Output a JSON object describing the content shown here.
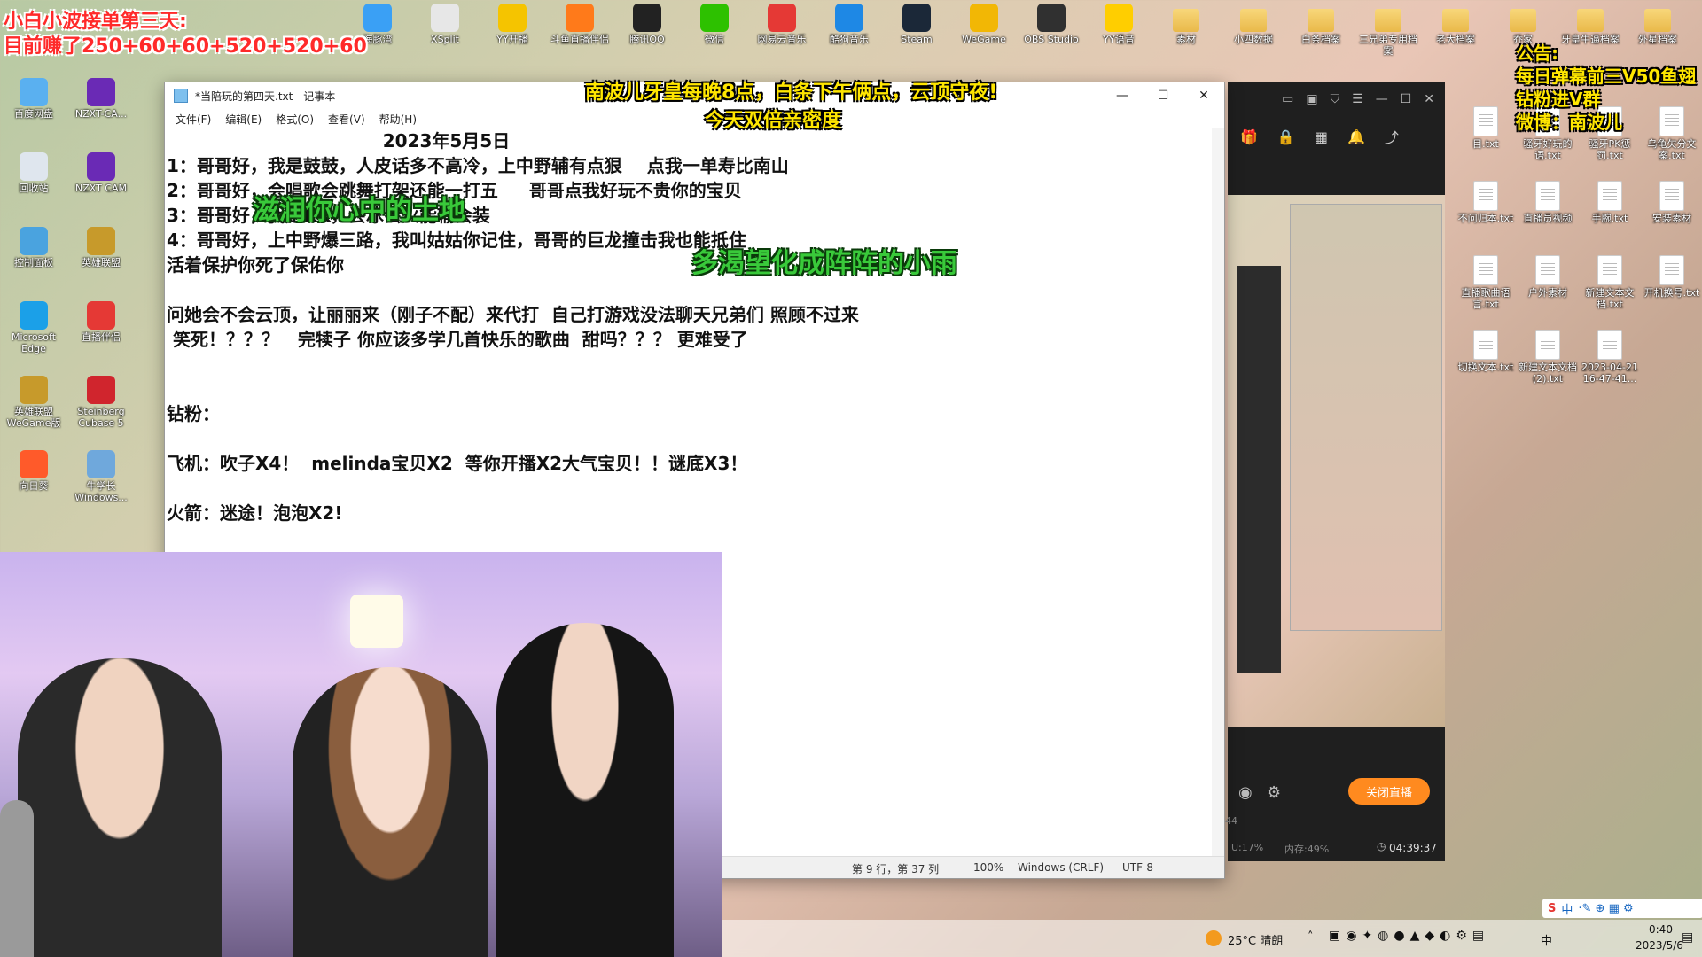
{
  "overlays": {
    "topleft_line1": "小白小波接单第三天:",
    "topleft_line2": "目前赚了250+60+60+520+520+60",
    "center_line1": "南波儿牙皇每晚8点，白条下午俩点，云顶守夜!",
    "center_line2": "今天双倍亲密度",
    "right_line1": "公告:",
    "right_line2": "每日弹幕前三V50鱼翅",
    "right_line3": "钻粉进V群",
    "right_line4": "微博：南波儿",
    "green_1": "滋润你心中的土地",
    "green_2": "多渴望化成阵阵的小雨"
  },
  "desktop_top_icons": [
    "海豚湾",
    "XSplit",
    "YY开播",
    "斗鱼直播伴侣",
    "腾讯QQ",
    "微信",
    "网易云音乐",
    "酷狗音乐",
    "Steam",
    "WeGame",
    "OBS Studio",
    "YY语音",
    "素材",
    "小四数据",
    "白条档案",
    "三兄弟专用档案",
    "老大档案",
    "乔家",
    "牙皇牛逼档案",
    "外星档案"
  ],
  "desktop_left_icons": [
    {
      "label": "百度网盘"
    },
    {
      "label": "NZXT-CA..."
    },
    {
      "label": "回收站"
    },
    {
      "label": "NZXT CAM"
    },
    {
      "label": "控制面板"
    },
    {
      "label": "英雄联盟"
    },
    {
      "label": "Microsoft Edge"
    },
    {
      "label": "直播伴侣"
    },
    {
      "label": "英雄联盟 WeGame版"
    },
    {
      "label": "Steinberg Cubase 5"
    },
    {
      "label": "向日葵"
    },
    {
      "label": "牛学长 Windows..."
    }
  ],
  "desktop_right_files": [
    "目.txt",
    "骚牙好玩的语.txt",
    "骚牙PK惩罚.txt",
    "乌龟欠分文案.txt",
    "不问归本.txt",
    "直播员视频",
    "手腕.txt",
    "安装素材",
    "直播歌曲语言.txt",
    "户外素材",
    "新建文本文档.txt",
    "开机换号.txt",
    "切换文本.txt",
    "新建文本文档 (2).txt",
    "2023-04-21 16-47-41..."
  ],
  "notepad": {
    "title": "*当陪玩的第四天.txt - 记事本",
    "menu": [
      "文件(F)",
      "编辑(E)",
      "格式(O)",
      "查看(V)",
      "帮助(H)"
    ],
    "content": "                                   2023年5月5日\n1：哥哥好，我是鼓鼓，人皮话多不高冷，上中野辅有点狠    点我一单寿比南山\n2：哥哥好，会唱歌会跳舞打架还能一打五     哥哥点我好玩不贵你的宝贝\n3：哥哥好，我是KK，会冰会火能输会装\n4：哥哥好，上中野爆三路，我叫姑姑你记住，哥哥的巨龙撞击我也能抵住\n活着保护你死了保佑你\n\n问她会不会云顶，让丽丽来（刚子不配）来代打  自己打游戏没法聊天兄弟们 照顾不过来\n 笑死！？？？   完犊子 你应该多学几首快乐的歌曲  甜吗？？？ 更难受了\n\n\n钻粉：\n\n飞机：吹子X4！  melinda宝贝X2  等你开播X2大气宝贝！！谜底X3！\n\n火箭：迷途！泡泡X2!",
    "status": {
      "position": "第 9 行，第 37 列",
      "zoom": "100%",
      "line_ending": "Windows (CRLF)",
      "encoding": "UTF-8"
    }
  },
  "panel": {
    "live_button": "关闭直播",
    "timer": "04:39:37",
    "cpu": "U:17%",
    "mem": "内存:49%",
    "side_num": "44"
  },
  "taskbar": {
    "weather": "25°C 晴朗",
    "ime": "中",
    "time": "0:40",
    "date": "2023/5/6"
  },
  "colors": {
    "live_button": "#ff8a1f",
    "overlay_red": "#ff2a2a",
    "overlay_yellow": "#ffe600",
    "overlay_green": "#39c93a"
  }
}
